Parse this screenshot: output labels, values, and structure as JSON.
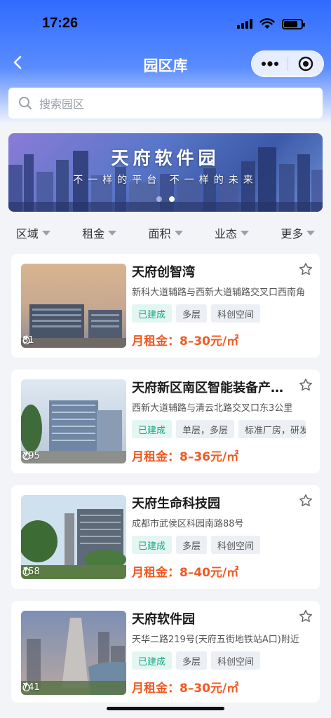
{
  "status_bar": {
    "time": "17:26",
    "battery_level": 0.8
  },
  "nav": {
    "title": "园区库"
  },
  "search": {
    "placeholder": "搜索园区"
  },
  "banner": {
    "title": "天府软件园",
    "subtitle": "不一样的平台  不一样的未来",
    "slide_count": 2,
    "active_slide": 2
  },
  "filters": [
    {
      "label": "区域"
    },
    {
      "label": "租金"
    },
    {
      "label": "面积"
    },
    {
      "label": "业态"
    },
    {
      "label": "更多"
    }
  ],
  "parks": [
    {
      "name": "天府创智湾",
      "address": "新科大道辅路与西新大道辅路交叉口西南角",
      "heat": "81",
      "tags": [
        "已建成",
        "多层",
        "科创空间"
      ],
      "rent": "月租金：8–30元/㎡"
    },
    {
      "name": "天府新区南区智能装备产业园",
      "address": "西新大道辅路与清云北路交叉口东3公里",
      "heat": "295",
      "tags": [
        "已建成",
        "单层，多层",
        "标准厂房，研发"
      ],
      "rent": "月租金：8–36元/㎡"
    },
    {
      "name": "天府生命科技园",
      "address": "成都市武侯区科园南路88号",
      "heat": "158",
      "tags": [
        "已建成",
        "多层",
        "科创空间"
      ],
      "rent": "月租金：8–40元/㎡"
    },
    {
      "name": "天府软件园",
      "address": "天华二路219号(天府五街地铁站A口)附近",
      "heat": "741",
      "tags": [
        "已建成",
        "多层",
        "科创空间"
      ],
      "rent": "月租金：8–30元/㎡"
    }
  ],
  "colors": {
    "accent": "#2f6bff",
    "price": "#f05a22",
    "built_tag": "#1aa886"
  }
}
